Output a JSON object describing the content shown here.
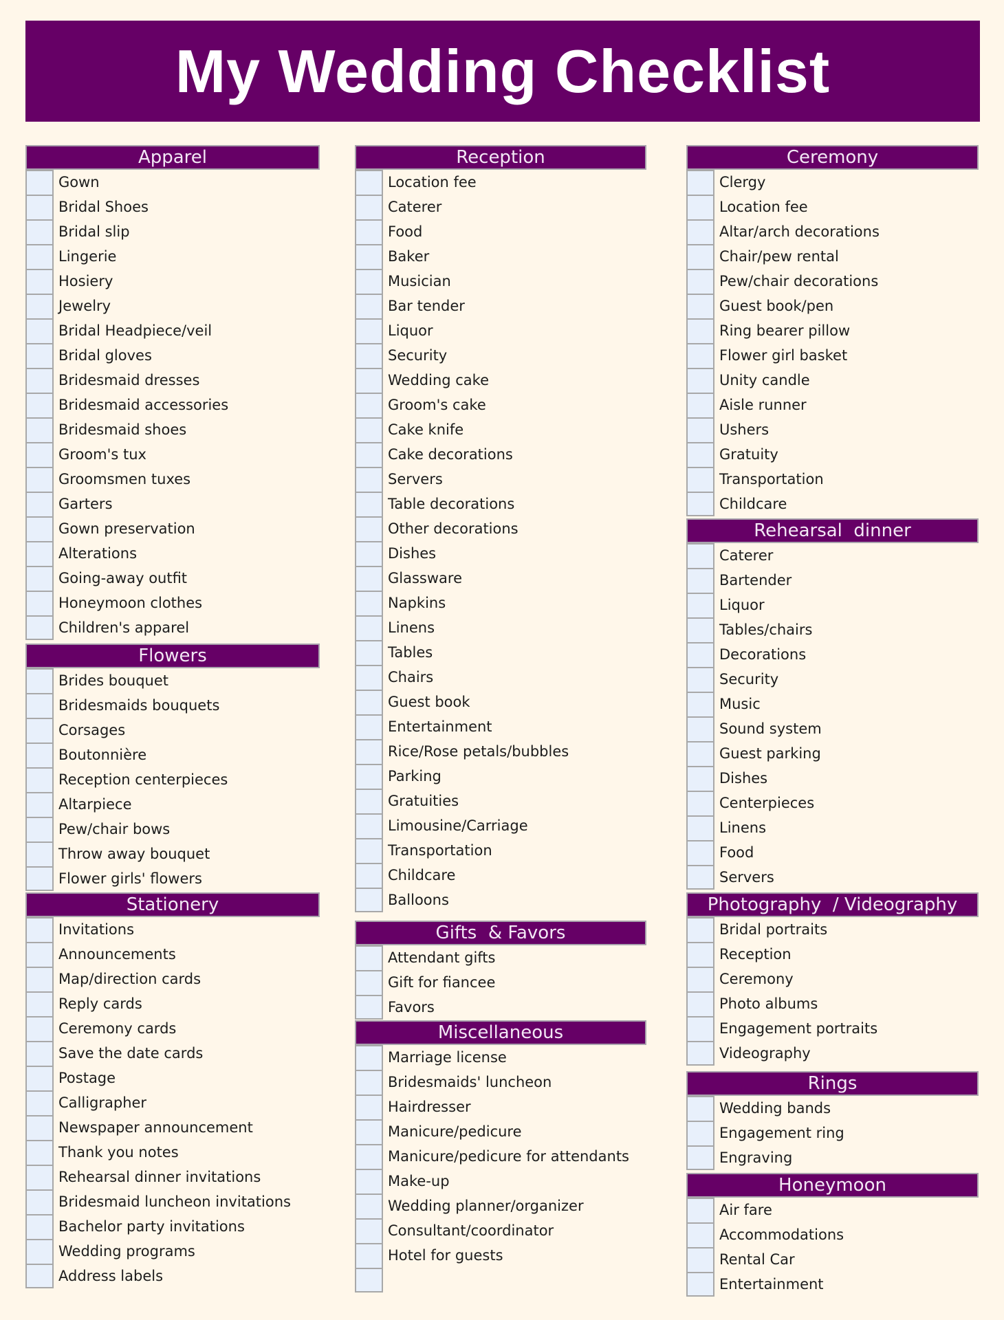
{
  "title": "My Wedding Checklist",
  "colors": {
    "header": "#660066",
    "checkbox": "#e8f0fb",
    "background": "#fff7ea"
  },
  "sections": {
    "apparel": {
      "title": "Apparel",
      "items": [
        "Gown",
        "Bridal Shoes",
        "Bridal slip",
        "Lingerie",
        "Hosiery",
        "Jewelry",
        "Bridal Headpiece/veil",
        "Bridal gloves",
        "Bridesmaid dresses",
        "Bridesmaid accessories",
        "Bridesmaid shoes",
        "Groom's tux",
        "Groomsmen tuxes",
        "Garters",
        "Gown preservation",
        "Alterations",
        "Going-away outfit",
        "Honeymoon clothes",
        "Children's apparel"
      ]
    },
    "flowers": {
      "title": "Flowers",
      "items": [
        "Brides bouquet",
        "Bridesmaids bouquets",
        "Corsages",
        "Boutonnière",
        "Reception centerpieces",
        "Altarpiece",
        "Pew/chair bows",
        "Throw away bouquet",
        "Flower girls' flowers"
      ]
    },
    "stationery": {
      "title": "Stationery",
      "items": [
        "Invitations",
        "Announcements",
        "Map/direction cards",
        "Reply cards",
        "Ceremony cards",
        "Save the date cards",
        "Postage",
        "Calligrapher",
        "Newspaper announcement",
        "Thank you notes",
        "Rehearsal dinner invitations",
        "Bridesmaid luncheon invitations",
        "Bachelor party invitations",
        "Wedding programs",
        "Address labels"
      ]
    },
    "reception": {
      "title": "Reception",
      "items": [
        "Location fee",
        "Caterer",
        "Food",
        "Baker",
        "Musician",
        "Bar tender",
        "Liquor",
        "Security",
        "Wedding cake",
        "Groom's cake",
        "Cake knife",
        "Cake decorations",
        "Servers",
        "Table decorations",
        "Other decorations",
        "Dishes",
        "Glassware",
        "Napkins",
        "Linens",
        "Tables",
        "Chairs",
        "Guest book",
        "Entertainment",
        "Rice/Rose petals/bubbles",
        "Parking",
        "Gratuities",
        "Limousine/Carriage",
        "Transportation",
        "Childcare",
        "Balloons"
      ]
    },
    "gifts": {
      "title": "Gifts  & Favors",
      "items": [
        "Attendant gifts",
        "Gift for fiancee",
        "Favors"
      ]
    },
    "misc": {
      "title": "Miscellaneous",
      "items": [
        "Marriage license",
        "Bridesmaids' luncheon",
        "Hairdresser",
        "Manicure/pedicure",
        "Manicure/pedicure for attendants",
        "Make-up",
        "Wedding planner/organizer",
        "Consultant/coordinator",
        "Hotel for guests",
        ""
      ]
    },
    "ceremony": {
      "title": "Ceremony",
      "items": [
        "Clergy",
        "Location fee",
        "Altar/arch decorations",
        "Chair/pew rental",
        "Pew/chair decorations",
        "Guest book/pen",
        "Ring bearer pillow",
        "Flower girl basket",
        "Unity candle",
        "Aisle runner",
        "Ushers",
        "Gratuity",
        "Transportation",
        "Childcare"
      ]
    },
    "rehearsal": {
      "title": "Rehearsal  dinner",
      "items": [
        "Caterer",
        "Bartender",
        "Liquor",
        "Tables/chairs",
        "Decorations",
        "Security",
        "Music",
        "Sound system",
        "Guest parking",
        "Dishes",
        "Centerpieces",
        "Linens",
        "Food",
        "Servers"
      ]
    },
    "photo": {
      "title": "Photography  / Videography",
      "items": [
        "Bridal portraits",
        "Reception",
        "Ceremony",
        "Photo albums",
        "Engagement portraits",
        "Videography"
      ]
    },
    "rings": {
      "title": "Rings",
      "items": [
        "Wedding bands",
        "Engagement ring",
        "Engraving"
      ]
    },
    "honeymoon": {
      "title": "Honeymoon",
      "items": [
        "Air fare",
        "Accommodations",
        "Rental Car",
        "Entertainment"
      ]
    }
  }
}
